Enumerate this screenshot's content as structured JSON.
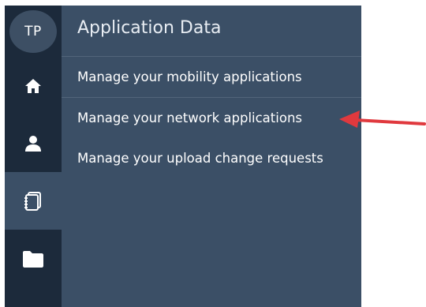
{
  "user": {
    "initials": "TP"
  },
  "rail": {
    "items": [
      {
        "icon": "home-icon",
        "active": false
      },
      {
        "icon": "user-icon",
        "active": false
      },
      {
        "icon": "notebook-icon",
        "active": true
      },
      {
        "icon": "folder-icon",
        "active": false
      }
    ]
  },
  "panel": {
    "title": "Application Data",
    "items": [
      {
        "label": "Manage your mobility applications"
      },
      {
        "label": "Manage your network applications"
      },
      {
        "label": "Manage your upload change requests"
      }
    ]
  },
  "colors": {
    "rail_bg": "#1c2a3b",
    "panel_bg": "#3b4f66",
    "avatar_bg": "#3d4f64",
    "annotation_arrow": "#e0393e"
  }
}
